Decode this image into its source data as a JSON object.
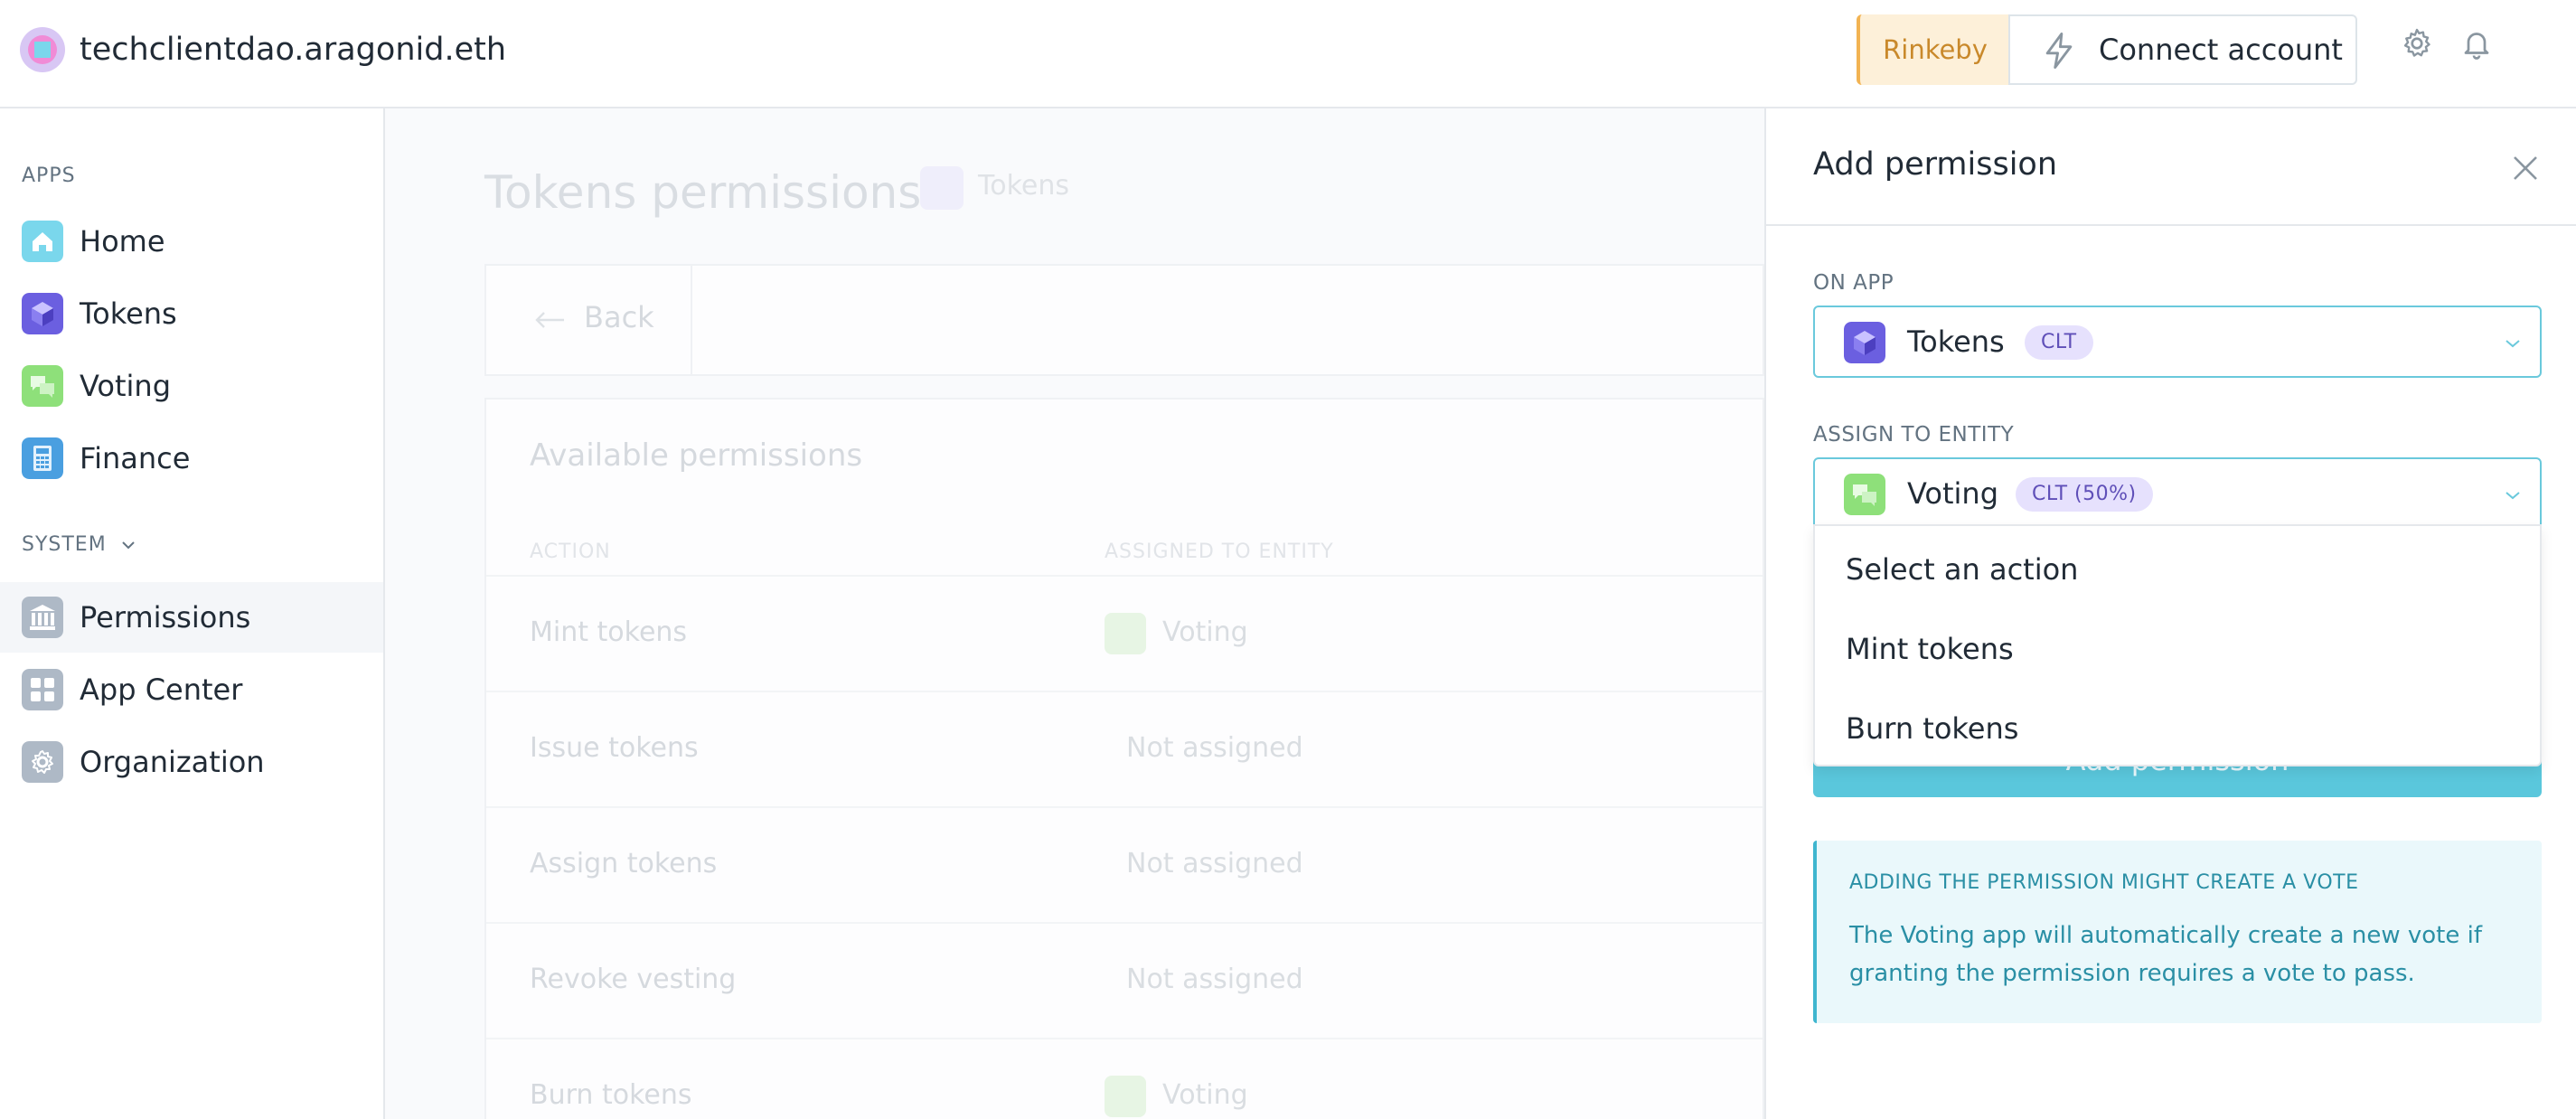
{
  "header": {
    "org_name": "techclientdao.aragonid.eth",
    "network": "Rinkeby",
    "connect_label": "Connect account",
    "settings_icon": "gear-icon",
    "notifications_icon": "bell-icon"
  },
  "sidebar": {
    "apps_label": "APPS",
    "apps": [
      {
        "label": "Home",
        "icon": "home-icon",
        "color": "#7ad7ec"
      },
      {
        "label": "Tokens",
        "icon": "tokens-icon",
        "color": "#6b5fe0"
      },
      {
        "label": "Voting",
        "icon": "voting-icon",
        "color": "#8ee07a"
      },
      {
        "label": "Finance",
        "icon": "finance-icon",
        "color": "#4a9fe0"
      }
    ],
    "system_label": "SYSTEM",
    "system": [
      {
        "label": "Permissions",
        "icon": "permissions-icon"
      },
      {
        "label": "App Center",
        "icon": "app-center-icon"
      },
      {
        "label": "Organization",
        "icon": "organization-icon"
      }
    ]
  },
  "main": {
    "title": "Tokens permissions",
    "app_badge": "Tokens",
    "back_label": "Back",
    "card_title": "Available permissions",
    "col_action": "ACTION",
    "col_entity": "ASSIGNED TO ENTITY",
    "rows": [
      {
        "action": "Mint tokens",
        "entity": "Voting"
      },
      {
        "action": "Issue tokens",
        "entity": "Not assigned"
      },
      {
        "action": "Assign tokens",
        "entity": "Not assigned"
      },
      {
        "action": "Revoke vesting",
        "entity": "Not assigned"
      },
      {
        "action": "Burn tokens",
        "entity": "Voting"
      }
    ]
  },
  "panel": {
    "title": "Add permission",
    "on_app_label": "ON APP",
    "on_app": {
      "name": "Tokens",
      "badge": "CLT"
    },
    "assign_label": "ASSIGN TO ENTITY",
    "assign": {
      "name": "Voting",
      "badge": "CLT (50%)"
    },
    "dropdown_options": [
      "Select an action",
      "Mint tokens",
      "Burn tokens"
    ],
    "submit_label": "Add permission",
    "info_title": "ADDING THE PERMISSION MIGHT CREATE A VOTE",
    "info_text": "The Voting app will automatically create a new vote if granting the permission requires a vote to pass."
  },
  "colors": {
    "accent": "#5ac7dc",
    "network_bg": "#fdf0d9",
    "pill_bg": "#e6e1fd",
    "pill_text": "#5f4fb8",
    "info_bg": "#eaf8fb"
  }
}
